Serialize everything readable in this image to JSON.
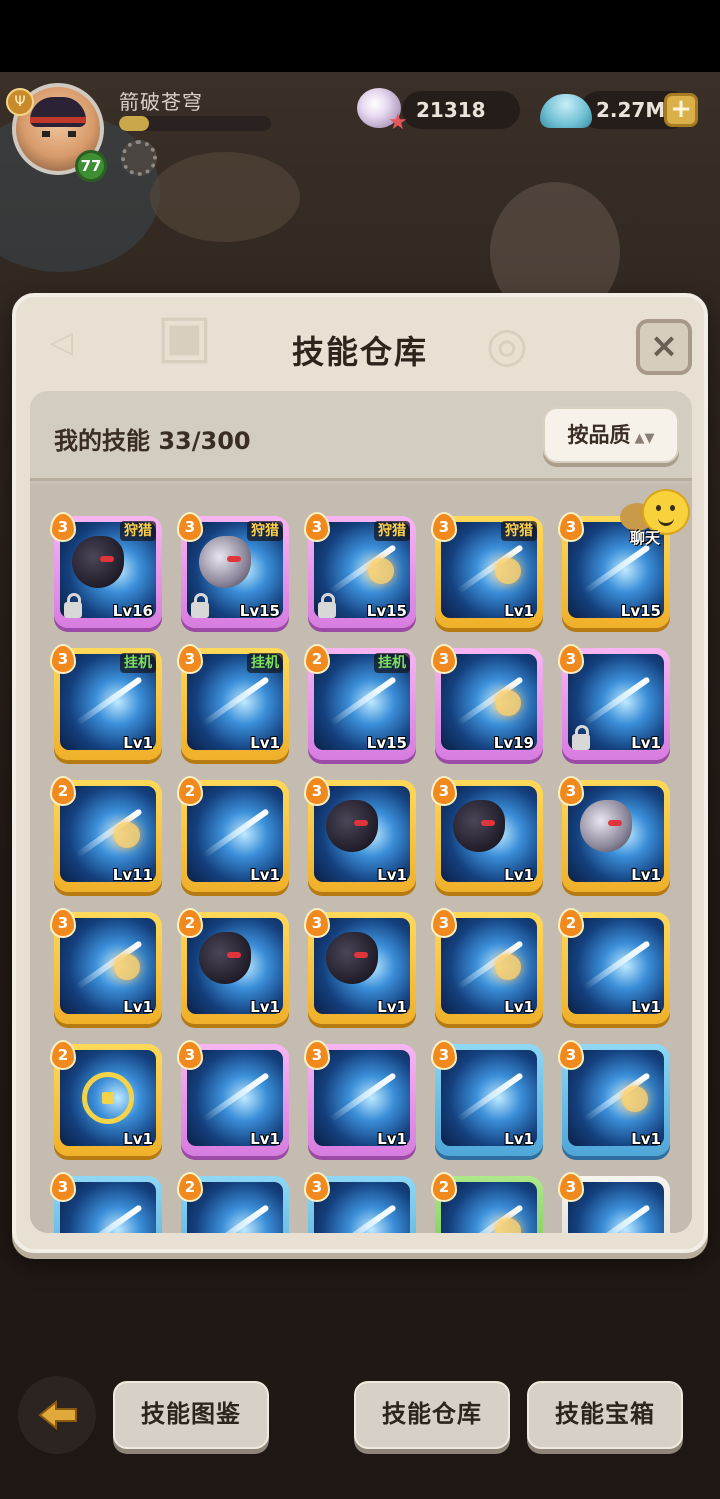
{
  "player": {
    "name": "箭破苍穹",
    "level": "77",
    "exp_fraction": 0.2
  },
  "currencies": {
    "pearls": "21318",
    "shells": "2.27M"
  },
  "panel": {
    "title": "技能仓库",
    "close_label": "×",
    "skill_count": "我的技能 33/300",
    "sort_label": "按品质",
    "sort_arrows": "▲▼"
  },
  "chat": {
    "label": "聊天"
  },
  "skills": [
    {
      "rank": "3",
      "tag": "狩猎",
      "tag_type": "hunt",
      "level": "Lv16",
      "locked": true,
      "frame": "purple",
      "art": "beast-dark"
    },
    {
      "rank": "3",
      "tag": "狩猎",
      "tag_type": "hunt",
      "level": "Lv15",
      "locked": true,
      "frame": "purple",
      "art": "beast-light"
    },
    {
      "rank": "3",
      "tag": "狩猎",
      "tag_type": "hunt",
      "level": "Lv15",
      "locked": true,
      "frame": "purple",
      "art": "arrow-burst"
    },
    {
      "rank": "3",
      "tag": "狩猎",
      "tag_type": "hunt",
      "level": "Lv1",
      "locked": false,
      "frame": "gold",
      "art": "arrow-burst"
    },
    {
      "rank": "3",
      "tag": "",
      "tag_type": "",
      "level": "Lv15",
      "locked": false,
      "frame": "gold",
      "art": "arrow"
    },
    {
      "rank": "3",
      "tag": "挂机",
      "tag_type": "idle",
      "level": "Lv1",
      "locked": false,
      "frame": "gold",
      "art": "arrow"
    },
    {
      "rank": "3",
      "tag": "挂机",
      "tag_type": "idle",
      "level": "Lv1",
      "locked": false,
      "frame": "gold",
      "art": "arrow"
    },
    {
      "rank": "2",
      "tag": "挂机",
      "tag_type": "idle",
      "level": "Lv15",
      "locked": false,
      "frame": "purple",
      "art": "arrow"
    },
    {
      "rank": "3",
      "tag": "",
      "tag_type": "",
      "level": "Lv19",
      "locked": false,
      "frame": "purple",
      "art": "arrow-burst"
    },
    {
      "rank": "3",
      "tag": "",
      "tag_type": "",
      "level": "Lv1",
      "locked": true,
      "frame": "purple",
      "art": "arrow"
    },
    {
      "rank": "2",
      "tag": "",
      "tag_type": "",
      "level": "Lv11",
      "locked": false,
      "frame": "gold",
      "art": "arrow-burst"
    },
    {
      "rank": "2",
      "tag": "",
      "tag_type": "",
      "level": "Lv1",
      "locked": false,
      "frame": "gold",
      "art": "arrow"
    },
    {
      "rank": "3",
      "tag": "",
      "tag_type": "",
      "level": "Lv1",
      "locked": false,
      "frame": "gold",
      "art": "beast-dark"
    },
    {
      "rank": "3",
      "tag": "",
      "tag_type": "",
      "level": "Lv1",
      "locked": false,
      "frame": "gold",
      "art": "beast-dark"
    },
    {
      "rank": "3",
      "tag": "",
      "tag_type": "",
      "level": "Lv1",
      "locked": false,
      "frame": "gold",
      "art": "beast-light"
    },
    {
      "rank": "3",
      "tag": "",
      "tag_type": "",
      "level": "Lv1",
      "locked": false,
      "frame": "gold",
      "art": "arrow-burst"
    },
    {
      "rank": "2",
      "tag": "",
      "tag_type": "",
      "level": "Lv1",
      "locked": false,
      "frame": "gold",
      "art": "beast-dark"
    },
    {
      "rank": "3",
      "tag": "",
      "tag_type": "",
      "level": "Lv1",
      "locked": false,
      "frame": "gold",
      "art": "beast-dark"
    },
    {
      "rank": "3",
      "tag": "",
      "tag_type": "",
      "level": "Lv1",
      "locked": false,
      "frame": "gold",
      "art": "arrow-burst"
    },
    {
      "rank": "2",
      "tag": "",
      "tag_type": "",
      "level": "Lv1",
      "locked": false,
      "frame": "gold",
      "art": "arrow"
    },
    {
      "rank": "2",
      "tag": "",
      "tag_type": "",
      "level": "Lv1",
      "locked": false,
      "frame": "gold",
      "art": "target"
    },
    {
      "rank": "3",
      "tag": "",
      "tag_type": "",
      "level": "Lv1",
      "locked": false,
      "frame": "purple",
      "art": "arrow"
    },
    {
      "rank": "3",
      "tag": "",
      "tag_type": "",
      "level": "Lv1",
      "locked": false,
      "frame": "purple",
      "art": "arrow"
    },
    {
      "rank": "3",
      "tag": "",
      "tag_type": "",
      "level": "Lv1",
      "locked": false,
      "frame": "blue",
      "art": "arrow"
    },
    {
      "rank": "3",
      "tag": "",
      "tag_type": "",
      "level": "Lv1",
      "locked": false,
      "frame": "blue",
      "art": "arrow-burst"
    },
    {
      "rank": "3",
      "tag": "",
      "tag_type": "",
      "level": "",
      "locked": false,
      "frame": "blue",
      "art": "arrow"
    },
    {
      "rank": "2",
      "tag": "",
      "tag_type": "",
      "level": "",
      "locked": false,
      "frame": "blue",
      "art": "arrow"
    },
    {
      "rank": "3",
      "tag": "",
      "tag_type": "",
      "level": "",
      "locked": false,
      "frame": "blue",
      "art": "arrow"
    },
    {
      "rank": "2",
      "tag": "",
      "tag_type": "",
      "level": "",
      "locked": false,
      "frame": "green",
      "art": "arrow-burst"
    },
    {
      "rank": "3",
      "tag": "",
      "tag_type": "",
      "level": "",
      "locked": false,
      "frame": "white",
      "art": "arrow"
    }
  ],
  "bottom_nav": {
    "back_icon": "back-arrow-icon",
    "codex_label": "技能图鉴",
    "storage_label": "技能仓库",
    "chest_label": "技能宝箱"
  },
  "colors": {
    "gold_frame": "#f0b02a",
    "purple_frame": "#d77ce0",
    "blue_frame": "#4ea6d8",
    "hunt_tag": "#ffd24a",
    "idle_tag": "#7de05a"
  }
}
